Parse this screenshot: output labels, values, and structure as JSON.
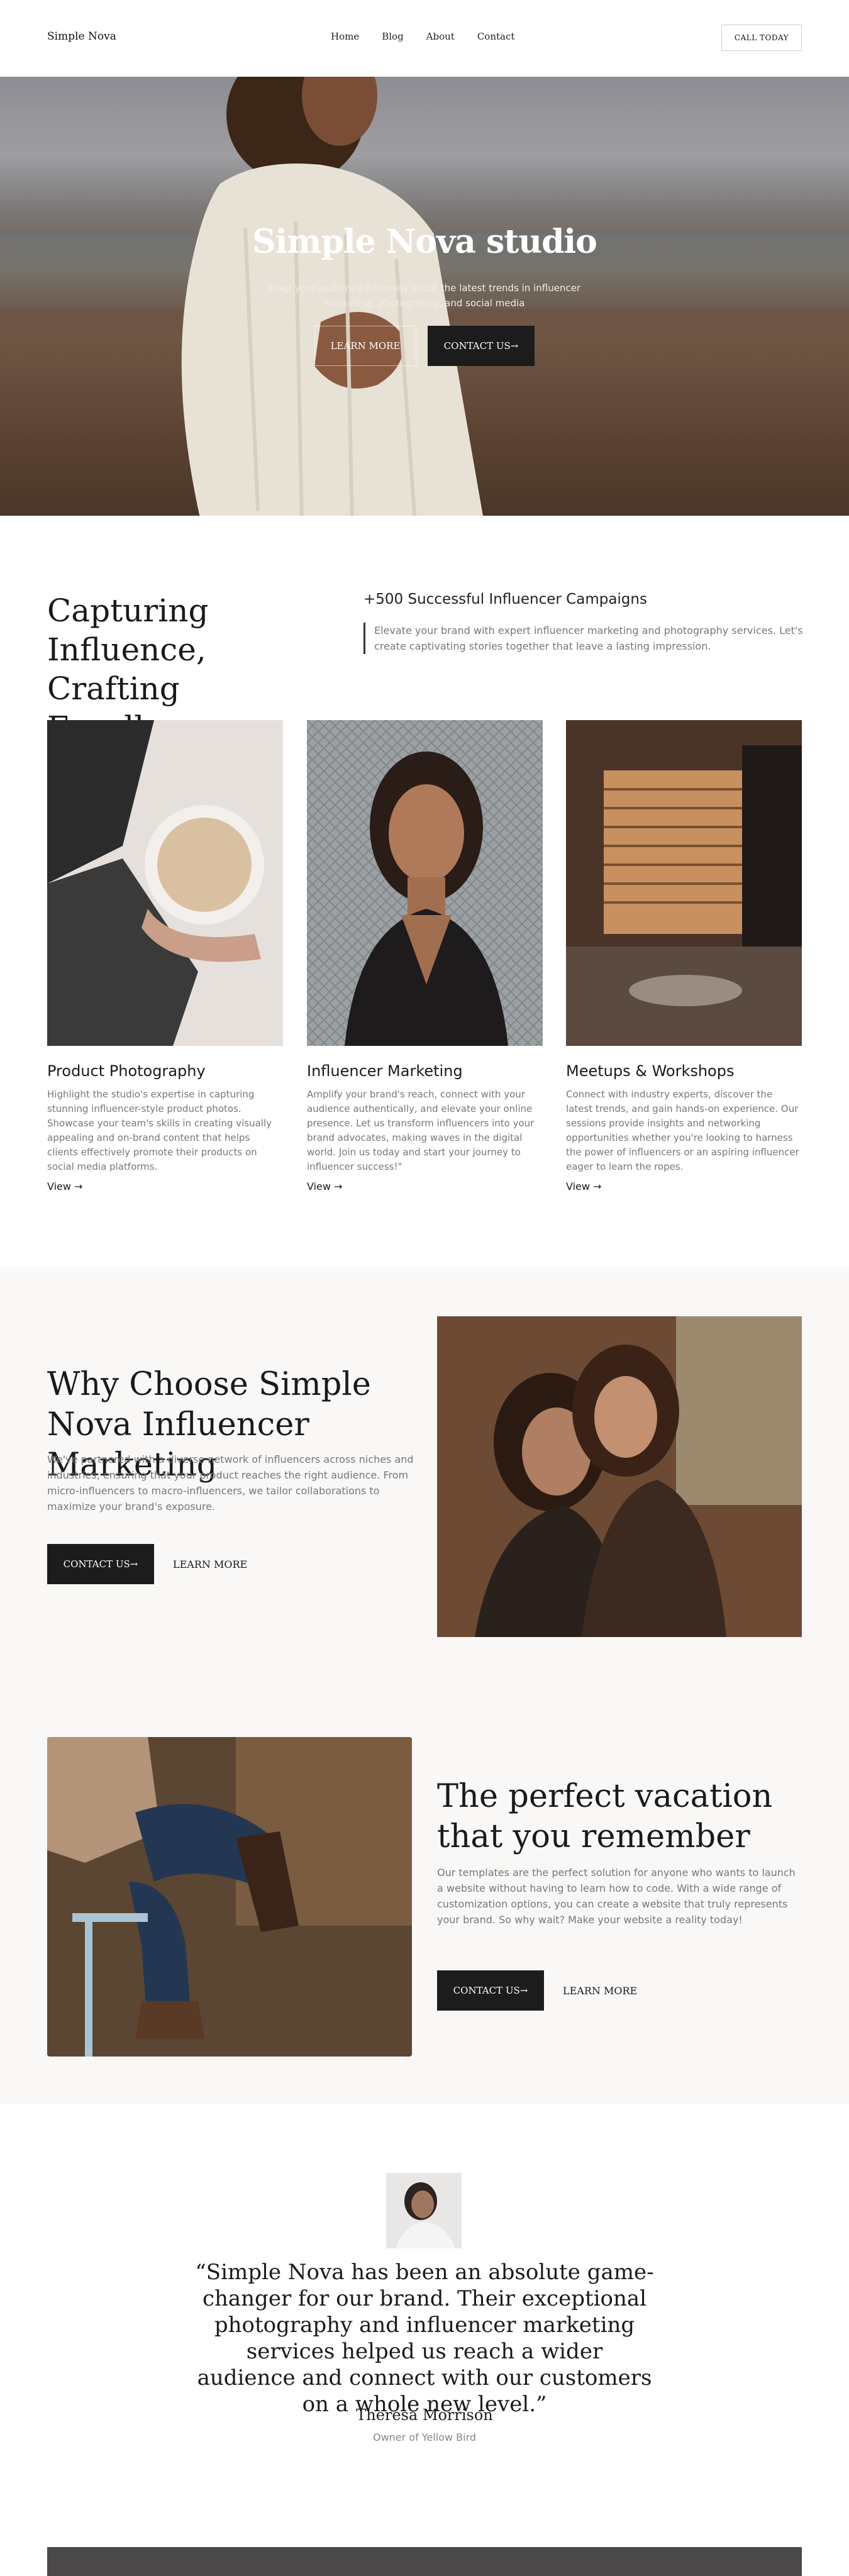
{
  "nav": {
    "brand": "Simple Nova",
    "links": [
      "Home",
      "Blog",
      "About",
      "Contact"
    ],
    "cta": "CALL TODAY"
  },
  "hero": {
    "title": "Simple Nova studio",
    "subtitle": "Keep your audience informed about the latest trends in influencer marketing, photography, and social media",
    "learn_more": "LEARN MORE",
    "contact": "CONTACT US→"
  },
  "intro": {
    "heading_line1": "Capturing Influence,",
    "heading_line2": "Crafting Excellence.",
    "stat_number": "+500",
    "stat_label": "Successful Influencer Campaigns",
    "paragraph": "Elevate your brand with expert influencer marketing and photography services. Let's create captivating stories together that leave a lasting impression."
  },
  "services": [
    {
      "title": "Product Photography",
      "text": "Highlight the studio's expertise in capturing stunning influencer-style product photos. Showcase your team's skills in creating visually appealing and on-brand content that helps clients effectively promote their products on social media platforms.",
      "link": "View →"
    },
    {
      "title": "Influencer Marketing",
      "text": "Amplify your brand's reach, connect with your audience authentically, and elevate your online presence. Let us transform influencers into your brand advocates, making waves in the digital world. Join us today and start your journey to influencer success!\"",
      "link": "View →"
    },
    {
      "title": "Meetups & Workshops",
      "text": "Connect with industry experts, discover the latest trends, and gain hands-on experience. Our sessions provide insights and networking opportunities whether you're looking to harness the power of influencers or an aspiring influencer eager to learn the ropes.",
      "link": "View →"
    }
  ],
  "why": {
    "heading": "Why Choose Simple Nova Influencer Marketing",
    "paragraph": "We've partnered with a diverse network of influencers across niches and industries, ensuring that your product reaches the right audience. From micro-influencers to macro-influencers, we tailor collaborations to maximize your brand's exposure.",
    "contact": "CONTACT US→",
    "learn_more": "LEARN MORE"
  },
  "vacation": {
    "heading": "The perfect vacation that you remember",
    "paragraph": "Our templates are the perfect solution for anyone who wants to launch a website without having to learn how to code. With a wide range of customization options, you can create a website that truly represents your brand. So why wait? Make your website a reality today!",
    "contact": "CONTACT US→",
    "learn_more": "LEARN MORE"
  },
  "testimonial": {
    "quote": "“Simple Nova has been an absolute game-changer for our brand. Their exceptional photography and influencer marketing services helped us reach a wider audience and connect with our customers on a whole new level.”",
    "name": "Theresa Morrison",
    "role": "Owner of Yellow Bird"
  }
}
